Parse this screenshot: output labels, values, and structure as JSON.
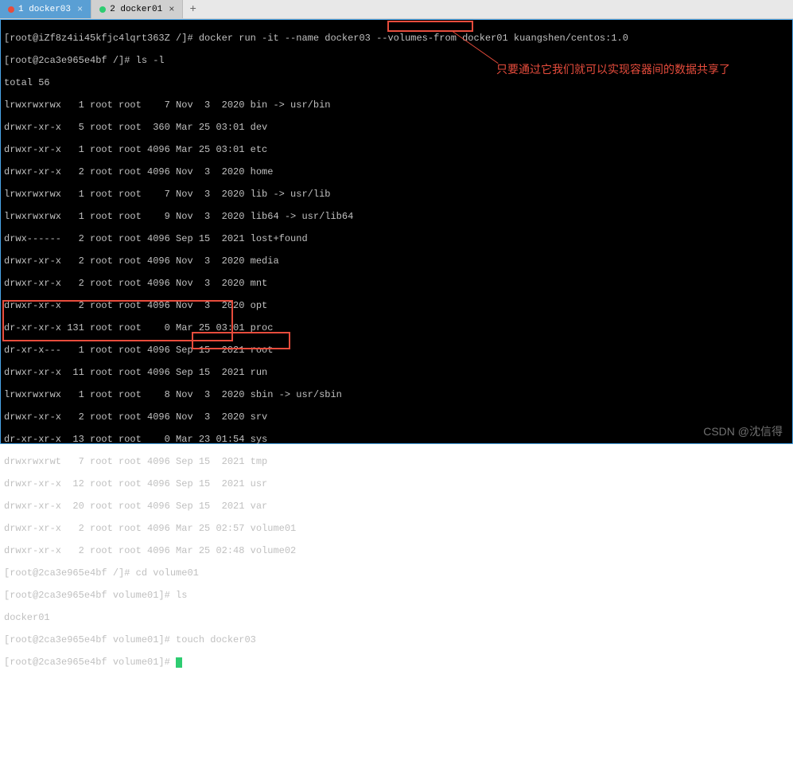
{
  "tabs": {
    "items": [
      {
        "label": "1 docker03",
        "indicator_color": "#e74c3c",
        "active": true
      },
      {
        "label": "2 docker01",
        "indicator_color": "#2ecc71",
        "active": false
      }
    ],
    "add_label": "+"
  },
  "terminal": {
    "cmd_line": "[root@iZf8z4ii45kfjc4lqrt363Z /]# docker run -it --name docker03 --volumes-from docker01 kuangshen/centos:1.0",
    "ls_cmd": "[root@2ca3e965e4bf /]# ls -l",
    "total": "total 56",
    "rows": [
      "lrwxrwxrwx   1 root root    7 Nov  3  2020 bin -> usr/bin",
      "drwxr-xr-x   5 root root  360 Mar 25 03:01 dev",
      "drwxr-xr-x   1 root root 4096 Mar 25 03:01 etc",
      "drwxr-xr-x   2 root root 4096 Nov  3  2020 home",
      "lrwxrwxrwx   1 root root    7 Nov  3  2020 lib -> usr/lib",
      "lrwxrwxrwx   1 root root    9 Nov  3  2020 lib64 -> usr/lib64",
      "drwx------   2 root root 4096 Sep 15  2021 lost+found",
      "drwxr-xr-x   2 root root 4096 Nov  3  2020 media",
      "drwxr-xr-x   2 root root 4096 Nov  3  2020 mnt",
      "drwxr-xr-x   2 root root 4096 Nov  3  2020 opt",
      "dr-xr-xr-x 131 root root    0 Mar 25 03:01 proc",
      "dr-xr-x---   1 root root 4096 Sep 15  2021 root",
      "drwxr-xr-x  11 root root 4096 Sep 15  2021 run",
      "lrwxrwxrwx   1 root root    8 Nov  3  2020 sbin -> usr/sbin",
      "drwxr-xr-x   2 root root 4096 Nov  3  2020 srv",
      "dr-xr-xr-x  13 root root    0 Mar 23 01:54 sys",
      "drwxrwxrwt   7 root root 4096 Sep 15  2021 tmp",
      "drwxr-xr-x  12 root root 4096 Sep 15  2021 usr",
      "drwxr-xr-x  20 root root 4096 Sep 15  2021 var",
      "drwxr-xr-x   2 root root 4096 Mar 25 02:57 volume01",
      "drwxr-xr-x   2 root root 4096 Mar 25 02:48 volume02"
    ],
    "cd_cmd": "[root@2ca3e965e4bf /]# cd volume01",
    "ls2_cmd": "[root@2ca3e965e4bf volume01]# ls",
    "ls2_out": "docker01",
    "touch_cmd": "[root@2ca3e965e4bf volume01]# touch docker03",
    "last_prompt": "[root@2ca3e965e4bf volume01]# "
  },
  "annotation": {
    "text": "只要通过它我们就可以实现容器间的数据共享了"
  },
  "watermark": "CSDN @沈信得"
}
